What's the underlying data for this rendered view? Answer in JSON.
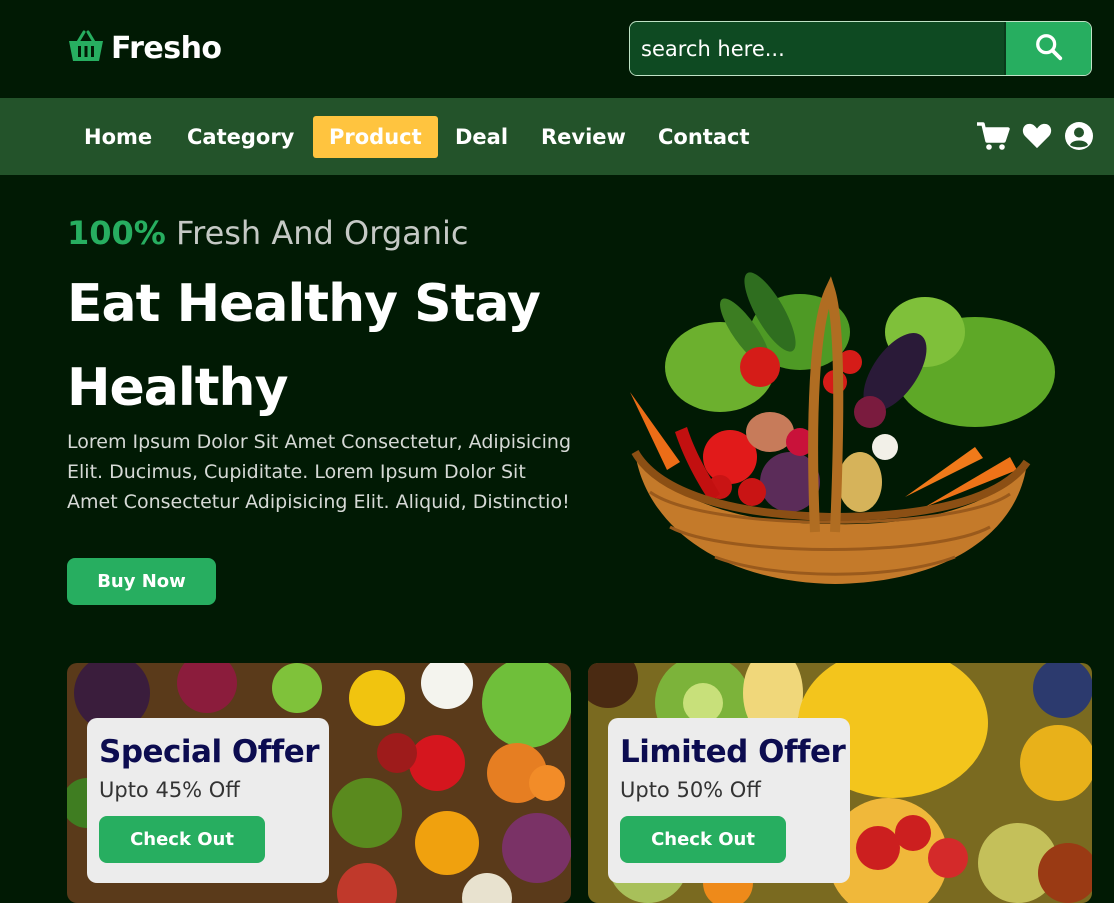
{
  "header": {
    "logo_text": "Fresho",
    "search_placeholder": "search here...",
    "search_icon": "search-icon"
  },
  "nav": {
    "items": [
      {
        "label": "Home"
      },
      {
        "label": "Category"
      },
      {
        "label": "Product",
        "active": true
      },
      {
        "label": "Deal"
      },
      {
        "label": "Review"
      },
      {
        "label": "Contact"
      }
    ],
    "icons": [
      "cart-icon",
      "heart-icon",
      "user-icon"
    ]
  },
  "hero": {
    "sub_highlight": "100%",
    "sub_rest": " Fresh And Organic",
    "title": "Eat Healthy Stay Healthy",
    "description": "Lorem Ipsum Dolor Sit Amet Consectetur, Adipisicing Elit. Ducimus, Cupiditate. Lorem Ipsum Dolor Sit Amet Consectetur Adipisicing Elit. Aliquid, Distinctio!",
    "button_label": "Buy Now"
  },
  "offers": [
    {
      "title": "Special Offer",
      "subtitle": "Upto 45% Off",
      "button_label": "Check Out"
    },
    {
      "title": "Limited Offer",
      "subtitle": "Upto 50% Off",
      "button_label": "Check Out"
    }
  ],
  "colors": {
    "background": "#011a04",
    "nav_background": "#23532a",
    "accent_green": "#27ae60",
    "active_nav": "#ffc43f",
    "offer_title": "#0c0c50"
  }
}
